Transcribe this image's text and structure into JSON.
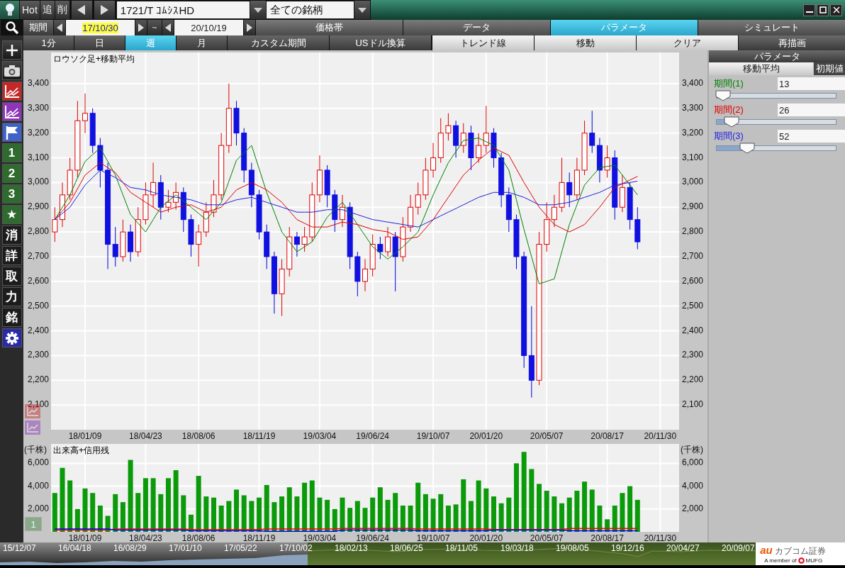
{
  "quick_buttons": [
    {
      "label": "Hot"
    },
    {
      "label": "追"
    },
    {
      "label": "削"
    }
  ],
  "symbol_field": {
    "value": "1721/T ｺﾑｼｽHD"
  },
  "filter_field": {
    "value": "全ての銘柄"
  },
  "period": {
    "label": "期間",
    "start": "17/10/30",
    "start_text_selected": true,
    "separator": "~",
    "end": "20/10/19"
  },
  "view_tabs": [
    {
      "label": "価格帯",
      "selected": false
    },
    {
      "label": "データ",
      "selected": false
    },
    {
      "label": "パラメータ",
      "selected": true
    },
    {
      "label": "シミュレート",
      "selected": false
    }
  ],
  "intervals": [
    {
      "label": "1分",
      "selected": false
    },
    {
      "label": "日",
      "selected": false
    },
    {
      "label": "週",
      "selected": true
    },
    {
      "label": "月",
      "selected": false
    },
    {
      "label": "カスタム期間",
      "selected": false
    },
    {
      "label": "USドル換算",
      "selected": false
    }
  ],
  "chart_buttons": [
    {
      "label": "トレンド線",
      "kind": "light"
    },
    {
      "label": "移動",
      "kind": "light"
    },
    {
      "label": "クリア",
      "kind": "light"
    },
    {
      "label": "再描画",
      "kind": "dark"
    }
  ],
  "side_tools": [
    {
      "kind": "search"
    },
    {
      "kind": "plus"
    },
    {
      "kind": "camera"
    },
    {
      "kind": "chart",
      "color": "#c62828"
    },
    {
      "kind": "chart",
      "color": "#8e35b8"
    },
    {
      "kind": "flag"
    },
    {
      "kind": "label",
      "label": "1",
      "color": "#2f6a2f"
    },
    {
      "kind": "label",
      "label": "2",
      "color": "#2f6a2f"
    },
    {
      "kind": "label",
      "label": "3",
      "color": "#2f6a2f"
    },
    {
      "kind": "label",
      "label": "★",
      "color": "#2f6a2f"
    },
    {
      "kind": "label",
      "label": "消",
      "color": "#1c1c1c"
    },
    {
      "kind": "label",
      "label": "詳",
      "color": "#1c1c1c"
    },
    {
      "kind": "label",
      "label": "取",
      "color": "#1c1c1c"
    },
    {
      "kind": "label",
      "label": "力",
      "color": "#1c1c1c"
    },
    {
      "kind": "label",
      "label": "銘",
      "color": "#1c1c1c"
    },
    {
      "kind": "gear"
    }
  ],
  "price_chart": {
    "title": "ロウソク足+移動平均",
    "chart_data": {
      "type": "candlestick",
      "grid": true,
      "ylim": [
        2000,
        3526
      ],
      "categories": [
        null,
        null,
        null,
        null,
        "18/01/09",
        null,
        null,
        null,
        null,
        null,
        null,
        null,
        "18/04/23",
        null,
        null,
        null,
        null,
        null,
        null,
        "18/08/06",
        null,
        null,
        null,
        null,
        null,
        null,
        null,
        "18/11/19",
        null,
        null,
        null,
        null,
        null,
        null,
        null,
        "19/03/04",
        null,
        null,
        null,
        null,
        null,
        null,
        "19/06/24",
        null,
        null,
        null,
        null,
        null,
        null,
        null,
        "19/10/07",
        null,
        null,
        null,
        null,
        null,
        null,
        "20/01/20",
        null,
        null,
        null,
        null,
        null,
        null,
        null,
        "20/05/07",
        null,
        null,
        null,
        null,
        null,
        null,
        null,
        "20/08/17",
        null,
        null,
        null,
        null,
        null,
        null,
        "20/11/30",
        null,
        null
      ],
      "yticks": [
        {
          "value": 3400,
          "label": "3,400"
        },
        {
          "value": 3300,
          "label": "3,300"
        },
        {
          "value": 3200,
          "label": "3,200"
        },
        {
          "value": 3100,
          "label": "3,100"
        },
        {
          "value": 3000,
          "label": "3,000"
        },
        {
          "value": 2900,
          "label": "2,900"
        },
        {
          "value": 2800,
          "label": "2,800"
        },
        {
          "value": 2700,
          "label": "2,700"
        },
        {
          "value": 2600,
          "label": "2,600"
        },
        {
          "value": 2500,
          "label": "2,500"
        },
        {
          "value": 2400,
          "label": "2,400"
        },
        {
          "value": 2300,
          "label": "2,300"
        },
        {
          "value": 2200,
          "label": "2,200"
        },
        {
          "value": 2100,
          "label": "2,100"
        }
      ],
      "ohlc": [
        [
          2800,
          2900,
          2760,
          2850
        ],
        [
          2850,
          3000,
          2820,
          2950
        ],
        [
          2950,
          3100,
          2930,
          3050
        ],
        [
          3050,
          3330,
          3020,
          3250
        ],
        [
          3250,
          3360,
          3200,
          3280
        ],
        [
          3280,
          3300,
          3120,
          3150
        ],
        [
          3150,
          3180,
          2980,
          3050
        ],
        [
          3050,
          3080,
          2650,
          2750
        ],
        [
          2750,
          2820,
          2660,
          2700
        ],
        [
          2700,
          2850,
          2680,
          2800
        ],
        [
          2800,
          2830,
          2680,
          2720
        ],
        [
          2720,
          2900,
          2700,
          2850
        ],
        [
          2850,
          3000,
          2830,
          2950
        ],
        [
          2950,
          3080,
          2900,
          3000
        ],
        [
          3000,
          3030,
          2850,
          2900
        ],
        [
          2900,
          2970,
          2880,
          2920
        ],
        [
          2920,
          3000,
          2890,
          2960
        ],
        [
          2960,
          2980,
          2800,
          2850
        ],
        [
          2850,
          2870,
          2700,
          2750
        ],
        [
          2750,
          2830,
          2660,
          2800
        ],
        [
          2800,
          2920,
          2780,
          2880
        ],
        [
          2880,
          3010,
          2860,
          2950
        ],
        [
          2950,
          3200,
          2930,
          3150
        ],
        [
          3150,
          3400,
          3120,
          3300
        ],
        [
          3300,
          3330,
          3150,
          3200
        ],
        [
          3200,
          3220,
          3000,
          3050
        ],
        [
          3050,
          3080,
          2900,
          2950
        ],
        [
          2950,
          2970,
          2770,
          2800
        ],
        [
          2800,
          2830,
          2650,
          2700
        ],
        [
          2700,
          2720,
          2470,
          2550
        ],
        [
          2550,
          2690,
          2460,
          2650
        ],
        [
          2650,
          2820,
          2620,
          2780
        ],
        [
          2780,
          2800,
          2700,
          2750
        ],
        [
          2750,
          2820,
          2720,
          2780
        ],
        [
          2780,
          3000,
          2760,
          2950
        ],
        [
          2950,
          3110,
          2920,
          3050
        ],
        [
          3050,
          3070,
          2900,
          2950
        ],
        [
          2950,
          2970,
          2800,
          2850
        ],
        [
          2850,
          2950,
          2820,
          2900
        ],
        [
          2900,
          2920,
          2650,
          2700
        ],
        [
          2700,
          2720,
          2540,
          2600
        ],
        [
          2600,
          2690,
          2560,
          2650
        ],
        [
          2650,
          2790,
          2620,
          2750
        ],
        [
          2750,
          2780,
          2690,
          2720
        ],
        [
          2720,
          2820,
          2700,
          2780
        ],
        [
          2780,
          2800,
          2560,
          2700
        ],
        [
          2700,
          2860,
          2680,
          2820
        ],
        [
          2820,
          2950,
          2800,
          2900
        ],
        [
          2900,
          3000,
          2870,
          2950
        ],
        [
          2950,
          3100,
          2930,
          3050
        ],
        [
          3050,
          3160,
          3020,
          3100
        ],
        [
          3100,
          3260,
          3080,
          3200
        ],
        [
          3200,
          3280,
          3170,
          3230
        ],
        [
          3230,
          3250,
          3100,
          3150
        ],
        [
          3150,
          3240,
          3120,
          3200
        ],
        [
          3200,
          3230,
          3050,
          3100
        ],
        [
          3100,
          3200,
          3080,
          3150
        ],
        [
          3150,
          3310,
          3120,
          3200
        ],
        [
          3200,
          3220,
          3060,
          3100
        ],
        [
          3100,
          3120,
          2900,
          2950
        ],
        [
          2950,
          2980,
          2800,
          2850
        ],
        [
          2850,
          2870,
          2650,
          2700
        ],
        [
          2700,
          2720,
          2250,
          2300
        ],
        [
          2300,
          2500,
          2130,
          2200
        ],
        [
          2200,
          2800,
          2180,
          2750
        ],
        [
          2750,
          2920,
          2720,
          2850
        ],
        [
          2850,
          2950,
          2820,
          2900
        ],
        [
          2900,
          3100,
          2880,
          3000
        ],
        [
          3000,
          3040,
          2900,
          2950
        ],
        [
          2950,
          3100,
          2930,
          3050
        ],
        [
          3050,
          3250,
          3030,
          3200
        ],
        [
          3200,
          3290,
          3120,
          3150
        ],
        [
          3150,
          3180,
          3000,
          3050
        ],
        [
          3050,
          3150,
          3020,
          3100
        ],
        [
          3100,
          3130,
          2850,
          2900
        ],
        [
          2900,
          3030,
          2880,
          2980
        ],
        [
          2980,
          3000,
          2810,
          2850
        ],
        [
          2850,
          2900,
          2730,
          2760
        ],
        null,
        null,
        null,
        null,
        null
      ],
      "series": [
        {
          "type": "line",
          "color": "#008000",
          "values": [
            2850,
            2900,
            2950,
            3018,
            3085,
            3113,
            3140,
            3085,
            3030,
            2950,
            2870,
            2835,
            2800,
            2850,
            2900,
            2925,
            2950,
            2925,
            2900,
            2875,
            2850,
            2885,
            2920,
            3005,
            3090,
            3120,
            3150,
            3055,
            2960,
            2880,
            2800,
            2760,
            2720,
            2740,
            2760,
            2810,
            2860,
            2890,
            2920,
            2875,
            2830,
            2785,
            2740,
            2715,
            2690,
            2715,
            2740,
            2770,
            2800,
            2875,
            2950,
            3015,
            3080,
            3125,
            3170,
            3175,
            3180,
            3165,
            3150,
            3100,
            3050,
            2930,
            2810,
            2700,
            2590,
            2600,
            2610,
            2720,
            2830,
            2910,
            2990,
            3025,
            3060,
            3065,
            3070,
            3030,
            2990,
            2950,
            null,
            null,
            null,
            null,
            null
          ]
        },
        {
          "type": "line",
          "color": "#e00000",
          "values": [
            2850,
            2885,
            2920,
            2975,
            3030,
            3055,
            3080,
            3060,
            3040,
            3000,
            2960,
            2940,
            2920,
            2900,
            2880,
            2890,
            2900,
            2905,
            2910,
            2895,
            2880,
            2890,
            2900,
            2935,
            2970,
            2985,
            3000,
            2985,
            2970,
            2945,
            2920,
            2885,
            2850,
            2835,
            2820,
            2820,
            2820,
            2830,
            2840,
            2835,
            2830,
            2820,
            2810,
            2805,
            2800,
            2785,
            2770,
            2775,
            2780,
            2815,
            2850,
            2895,
            2940,
            2985,
            3030,
            3060,
            3090,
            3115,
            3140,
            3125,
            3110,
            3055,
            3000,
            2950,
            2900,
            2865,
            2830,
            2815,
            2800,
            2815,
            2830,
            2865,
            2900,
            2940,
            2980,
            2995,
            3010,
            3025,
            null,
            null,
            null,
            null,
            null
          ]
        },
        {
          "type": "line",
          "color": "#2020e0",
          "values": [
            2850,
            2875,
            2900,
            2945,
            2990,
            3020,
            3050,
            3035,
            3020,
            3000,
            2980,
            2975,
            2970,
            2960,
            2950,
            2945,
            2940,
            2935,
            2930,
            2920,
            2910,
            2910,
            2910,
            2920,
            2930,
            2935,
            2940,
            2930,
            2920,
            2910,
            2900,
            2890,
            2880,
            2880,
            2880,
            2885,
            2890,
            2890,
            2890,
            2880,
            2870,
            2860,
            2850,
            2845,
            2840,
            2835,
            2830,
            2825,
            2820,
            2835,
            2850,
            2865,
            2880,
            2895,
            2910,
            2925,
            2940,
            2950,
            2960,
            2960,
            2960,
            2950,
            2940,
            2925,
            2910,
            2910,
            2910,
            2915,
            2920,
            2930,
            2940,
            2950,
            2960,
            2975,
            2990,
            2995,
            3000,
            3005,
            null,
            null,
            null,
            null,
            null
          ]
        }
      ]
    },
    "right_axis_labels": [
      "3,400",
      "3,300",
      "3,200",
      "3,100",
      "3,000",
      "2,900",
      "2,800",
      "2,700",
      "2,600",
      "2,500",
      "2,400",
      "2,300",
      "2,200",
      "2,100"
    ]
  },
  "volume_chart": {
    "title": "出来高+信用残",
    "unit_left": "(千株)",
    "unit_right": "(千株)",
    "page_button": "1",
    "chart_data": {
      "type": "bar",
      "grid": true,
      "ylim": [
        0,
        7700
      ],
      "categories": [
        null,
        null,
        null,
        null,
        "18/01/09",
        null,
        null,
        null,
        null,
        null,
        null,
        null,
        "18/04/23",
        null,
        null,
        null,
        null,
        null,
        null,
        "18/08/06",
        null,
        null,
        null,
        null,
        null,
        null,
        null,
        "18/11/19",
        null,
        null,
        null,
        null,
        null,
        null,
        null,
        "19/03/04",
        null,
        null,
        null,
        null,
        null,
        null,
        "19/06/24",
        null,
        null,
        null,
        null,
        null,
        null,
        null,
        "19/10/07",
        null,
        null,
        null,
        null,
        null,
        null,
        "20/01/20",
        null,
        null,
        null,
        null,
        null,
        null,
        null,
        "20/05/07",
        null,
        null,
        null,
        null,
        null,
        null,
        null,
        "20/08/17",
        null,
        null,
        null,
        null,
        null,
        null,
        "20/11/30",
        null,
        null
      ],
      "yticks": [
        {
          "value": 6000,
          "label": "6,000"
        },
        {
          "value": 4000,
          "label": "4,000"
        },
        {
          "value": 2000,
          "label": "2,000"
        }
      ],
      "series": [
        {
          "color": "#0a9a0a",
          "values": [
            3400,
            5600,
            4500,
            2000,
            3800,
            3400,
            2300,
            1400,
            3300,
            2600,
            6300,
            3400,
            4700,
            4700,
            3300,
            4700,
            5400,
            3200,
            1500,
            4900,
            3100,
            3000,
            2300,
            2700,
            3700,
            3200,
            2700,
            3000,
            4100,
            2600,
            3100,
            3900,
            3100,
            4300,
            4500,
            3000,
            2800,
            2000,
            3000,
            2100,
            2700,
            2100,
            3000,
            3900,
            2800,
            3400,
            2300,
            2300,
            4300,
            3300,
            2900,
            3300,
            2300,
            2400,
            4600,
            2700,
            4500,
            3800,
            3100,
            2500,
            3000,
            6000,
            7000,
            5500,
            4200,
            3600,
            3100,
            2500,
            3000,
            3600,
            4400,
            3700,
            2300,
            1100,
            2300,
            3400,
            4000,
            2800,
            null,
            null,
            null,
            null,
            null
          ]
        },
        {
          "type": "line",
          "color": "#ff0000",
          "values": [
            150,
            150,
            150,
            150,
            150,
            150,
            150,
            150,
            250,
            250,
            250,
            250,
            250,
            250,
            250,
            250,
            250,
            250,
            200,
            200,
            200,
            200,
            200,
            200,
            200,
            200,
            200,
            200,
            250,
            250,
            250,
            250,
            250,
            250,
            250,
            250,
            250,
            250,
            300,
            300,
            300,
            300,
            300,
            300,
            300,
            300,
            300,
            300,
            250,
            250,
            250,
            250,
            250,
            250,
            250,
            250,
            250,
            250,
            200,
            200,
            200,
            200,
            200,
            200,
            200,
            200,
            200,
            200,
            300,
            300,
            300,
            300,
            300,
            300,
            300,
            300,
            300,
            300,
            null,
            null,
            null,
            null,
            null
          ]
        },
        {
          "type": "line",
          "color": "#0000ff",
          "values": [
            250,
            250,
            250,
            250,
            250,
            250,
            250,
            250,
            150,
            150,
            150,
            150,
            150,
            150,
            150,
            150,
            150,
            150,
            100,
            100,
            100,
            100,
            100,
            100,
            100,
            100,
            100,
            100,
            50,
            50,
            50,
            50,
            50,
            50,
            50,
            50,
            50,
            50,
            150,
            150,
            150,
            150,
            150,
            150,
            150,
            150,
            150,
            150,
            100,
            100,
            100,
            100,
            100,
            100,
            100,
            100,
            100,
            100,
            150,
            150,
            150,
            150,
            150,
            150,
            150,
            150,
            150,
            150,
            100,
            100,
            100,
            100,
            100,
            100,
            100,
            100,
            100,
            100,
            null,
            null,
            null,
            null,
            null
          ]
        }
      ]
    },
    "right_axis_labels": [
      "6,000",
      "4,000",
      "2,000"
    ]
  },
  "parameters": {
    "title": "パラメータ",
    "tab": "移動平均",
    "reset_button": "初期値",
    "params": [
      {
        "label": "期間(1)",
        "color": "#008000",
        "value": "13",
        "level": 0.06
      },
      {
        "label": "期間(2)",
        "color": "#e00000",
        "value": "26",
        "level": 0.13
      },
      {
        "label": "期間(3)",
        "color": "#2020e0",
        "value": "52",
        "level": 0.26
      }
    ]
  },
  "navigator": {
    "labels": [
      "15/12/07",
      "16/04/18",
      "16/08/29",
      "17/01/10",
      "17/05/22",
      "17/10/02",
      "18/02/13",
      "18/06/25",
      "18/11/05",
      "19/03/18",
      "19/08/05",
      "19/12/16",
      "20/04/27",
      "20/09/07"
    ]
  },
  "logo": {
    "brand": "au",
    "name": "カブコム証券",
    "prefix": "A member of",
    "group": "MUFG"
  }
}
